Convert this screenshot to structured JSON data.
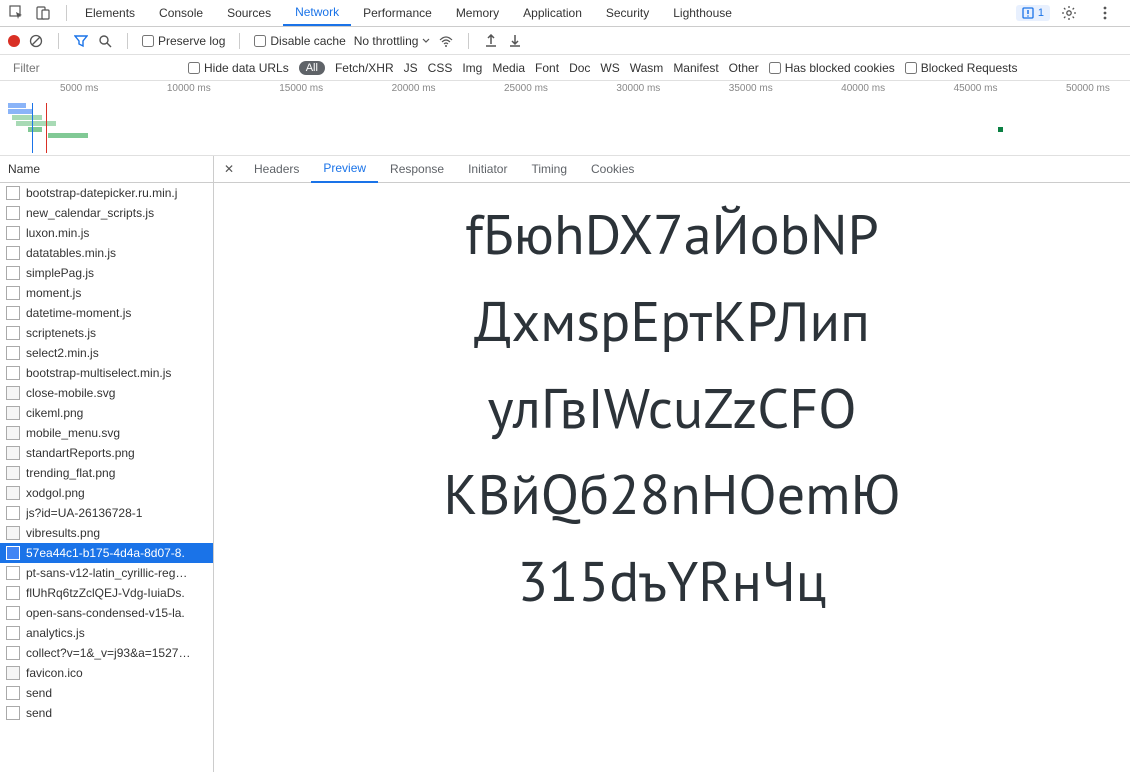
{
  "panels": [
    "Elements",
    "Console",
    "Sources",
    "Network",
    "Performance",
    "Memory",
    "Application",
    "Security",
    "Lighthouse"
  ],
  "activePanel": "Network",
  "issueCount": "1",
  "netBar": {
    "preserveLog": "Preserve log",
    "disableCache": "Disable cache",
    "throttling": "No throttling"
  },
  "filterBar": {
    "filterPlaceholder": "Filter",
    "hideDataUrls": "Hide data URLs",
    "all": "All",
    "types": [
      "Fetch/XHR",
      "JS",
      "CSS",
      "Img",
      "Media",
      "Font",
      "Doc",
      "WS",
      "Wasm",
      "Manifest",
      "Other"
    ],
    "hasBlockedCookies": "Has blocked cookies",
    "blockedRequests": "Blocked Requests"
  },
  "timelineTicks": [
    "5000 ms",
    "10000 ms",
    "15000 ms",
    "20000 ms",
    "25000 ms",
    "30000 ms",
    "35000 ms",
    "40000 ms",
    "45000 ms",
    "50000 ms"
  ],
  "nameHeader": "Name",
  "requests": [
    {
      "name": "bootstrap-datepicker.ru.min.j",
      "type": "js"
    },
    {
      "name": "new_calendar_scripts.js",
      "type": "js"
    },
    {
      "name": "luxon.min.js",
      "type": "js"
    },
    {
      "name": "datatables.min.js",
      "type": "js"
    },
    {
      "name": "simplePag.js",
      "type": "js"
    },
    {
      "name": "moment.js",
      "type": "js"
    },
    {
      "name": "datetime-moment.js",
      "type": "js"
    },
    {
      "name": "scriptenets.js",
      "type": "js"
    },
    {
      "name": "select2.min.js",
      "type": "js"
    },
    {
      "name": "bootstrap-multiselect.min.js",
      "type": "js"
    },
    {
      "name": "close-mobile.svg",
      "type": "img"
    },
    {
      "name": "cikeml.png",
      "type": "img"
    },
    {
      "name": "mobile_menu.svg",
      "type": "img"
    },
    {
      "name": "standartReports.png",
      "type": "img"
    },
    {
      "name": "trending_flat.png",
      "type": "img"
    },
    {
      "name": "xodgol.png",
      "type": "img"
    },
    {
      "name": "js?id=UA-26136728-1",
      "type": "js"
    },
    {
      "name": "vibresults.png",
      "type": "img"
    },
    {
      "name": "57ea44c1-b175-4d4a-8d07-8.",
      "type": "img",
      "selected": true
    },
    {
      "name": "pt-sans-v12-latin_cyrillic-reg…",
      "type": "font"
    },
    {
      "name": "flUhRq6tzZclQEJ-Vdg-IuiaDs.",
      "type": "font"
    },
    {
      "name": "open-sans-condensed-v15-la.",
      "type": "font"
    },
    {
      "name": "analytics.js",
      "type": "js"
    },
    {
      "name": "collect?v=1&_v=j93&a=1527…",
      "type": "other"
    },
    {
      "name": "favicon.ico",
      "type": "img"
    },
    {
      "name": "send",
      "type": "other"
    },
    {
      "name": "send",
      "type": "other"
    }
  ],
  "detailTabs": [
    "Headers",
    "Preview",
    "Response",
    "Initiator",
    "Timing",
    "Cookies"
  ],
  "activeDetailTab": "Preview",
  "previewText": "fБюhDX7аЙоbNР\nДxмspЕртКРЛип\nулГвIWcuZzСFО\nКВйQб28nНОеmЮ\n315dъYRнЧц"
}
